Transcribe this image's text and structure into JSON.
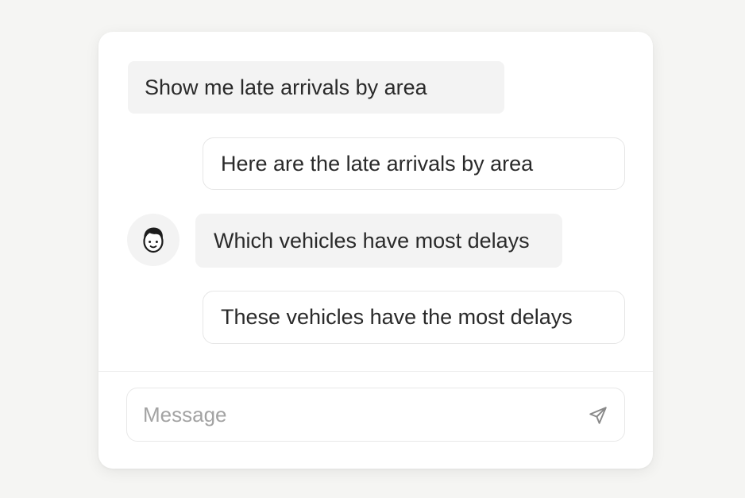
{
  "conversation": {
    "messages": [
      {
        "role": "user",
        "text": "Show me late arrivals by area"
      },
      {
        "role": "assistant",
        "text": "Here are the late arrivals by area"
      },
      {
        "role": "user",
        "text": "Which vehicles have most delays",
        "avatar_icon": "user-face-icon"
      },
      {
        "role": "assistant",
        "text": "These vehicles have the most delays"
      }
    ]
  },
  "composer": {
    "placeholder": "Message",
    "value": "",
    "send_icon": "send-icon"
  },
  "colors": {
    "background": "#f5f5f3",
    "card": "#ffffff",
    "user_bubble": "#f3f3f3",
    "border": "#e6e6e6",
    "text": "#2a2a2a",
    "placeholder": "#a3a3a3"
  }
}
